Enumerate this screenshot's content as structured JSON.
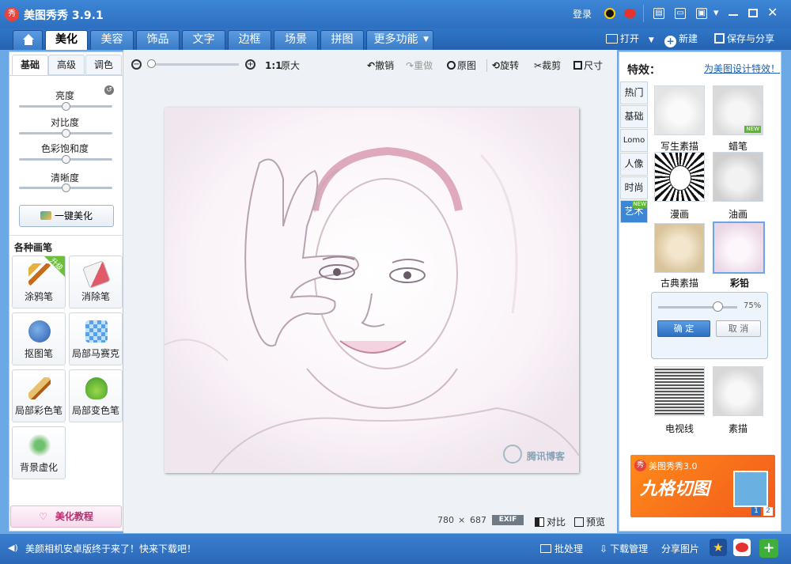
{
  "window": {
    "title": "美图秀秀 3.9.1",
    "logo_glyph": "秀",
    "login": "登录"
  },
  "nav": {
    "tabs": [
      {
        "label": "美化",
        "active": true
      },
      {
        "label": "美容"
      },
      {
        "label": "饰品"
      },
      {
        "label": "文字"
      },
      {
        "label": "边框"
      },
      {
        "label": "场景"
      },
      {
        "label": "拼图"
      },
      {
        "label": "更多功能"
      }
    ],
    "open": "打开",
    "new": "新建",
    "save_share": "保存与分享"
  },
  "left": {
    "subtabs": [
      "基础",
      "高级",
      "调色"
    ],
    "sliders": [
      {
        "label": "亮度",
        "value": 0.5
      },
      {
        "label": "对比度",
        "value": 0.5
      },
      {
        "label": "色彩饱和度",
        "value": 0.5
      },
      {
        "label": "清晰度",
        "value": 0.5
      }
    ],
    "one_click": "一键美化",
    "brushes_title": "各种画笔",
    "brushes": [
      "涂鸦笔",
      "消除笔",
      "抠图笔",
      "局部马赛克",
      "局部彩色笔",
      "局部变色笔",
      "背景虚化"
    ],
    "upgrade_badge": "升级",
    "tutorial": "美化教程"
  },
  "toolbar": {
    "zoom_value": 0.0,
    "one_to_one": "1:1",
    "original_size": "原大",
    "undo": "撤销",
    "redo": "重做",
    "original": "原图",
    "rotate": "旋转",
    "crop": "裁剪",
    "size": "尺寸"
  },
  "status": {
    "width": "780",
    "times": "×",
    "height": "687",
    "exif": "EXIF",
    "compare": "对比",
    "preview": "预览"
  },
  "canvas": {
    "watermark": "腾讯博客"
  },
  "right": {
    "heading": "特效：",
    "link": "为美图设计特效！",
    "vtabs": [
      "热门",
      "基础",
      "Lomo",
      "人像",
      "时尚",
      "艺术"
    ],
    "new_badge": "NEW",
    "effects": [
      "写生素描",
      "蜡笔",
      "漫画",
      "油画",
      "古典素描",
      "彩铅",
      "电视线",
      "素描"
    ],
    "selected_effect": "彩铅",
    "intensity": "75%",
    "intensity_value": 0.75,
    "confirm": "确 定",
    "cancel": "取 消",
    "ad": {
      "brand": "美图秀秀3.0",
      "title": "九格切图",
      "pages": [
        "1",
        "2"
      ]
    }
  },
  "bottom": {
    "news": "美颜相机安卓版终于来了！快来下载吧！",
    "batch": "批处理",
    "download": "下载管理",
    "share": "分享图片"
  },
  "colors": {
    "titlebar": "#2d6fc0",
    "accent": "#3c86d6",
    "red": "#e8423c"
  }
}
